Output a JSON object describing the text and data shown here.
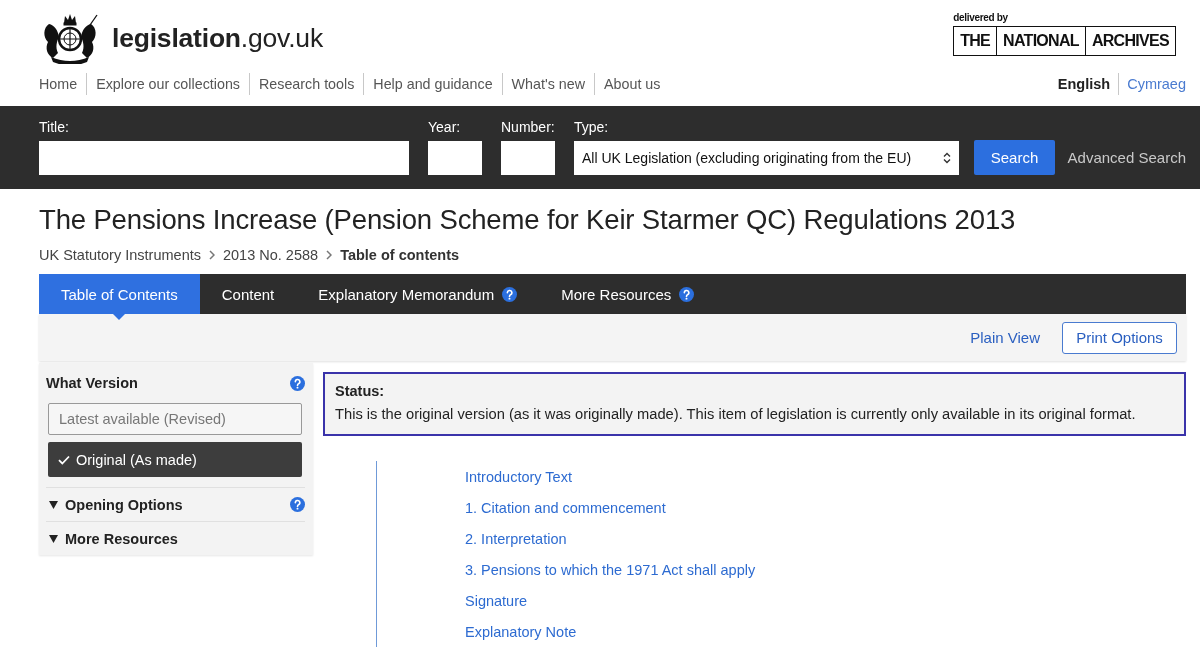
{
  "header": {
    "site_name": "**legislation**.gov.uk",
    "delivered_by": "delivered by",
    "archives_logo": [
      "THE",
      "NATIONAL",
      "ARCHIVES"
    ]
  },
  "nav": {
    "items": [
      "Home",
      "Explore our collections",
      "Research tools",
      "Help and guidance",
      "What's new",
      "About us"
    ],
    "languages": [
      {
        "label": "English",
        "selected": true
      },
      {
        "label": "Cymraeg",
        "selected": false
      }
    ]
  },
  "search": {
    "fields": [
      {
        "label": "Title:",
        "kind": "wide"
      },
      {
        "label": "Year:",
        "kind": "narrow"
      },
      {
        "label": "Number:",
        "kind": "narrow"
      },
      {
        "label": "Type:",
        "kind": "select",
        "value": "All UK Legislation (excluding originating from the EU)"
      }
    ],
    "button": "Search",
    "advanced_link": "Advanced Search"
  },
  "page_title": "The Pensions Increase (Pension Scheme for Keir Starmer QC) Regulations 2013",
  "breadcrumb": [
    {
      "label": "UK Statutory Instruments",
      "current": false
    },
    {
      "label": "2013 No. 2588",
      "current": false
    },
    {
      "label": "Table of contents",
      "current": true
    }
  ],
  "tabs": [
    {
      "label": "Table of Contents",
      "selected": true,
      "help": false
    },
    {
      "label": "Content",
      "selected": false,
      "help": false
    },
    {
      "label": "Explanatory Memorandum",
      "selected": false,
      "help": true
    },
    {
      "label": "More Resources",
      "selected": false,
      "help": true
    }
  ],
  "toolbar": {
    "plain_view": "Plain View",
    "print_options": "Print Options"
  },
  "sidebar": {
    "version": {
      "title": "What Version",
      "help": true,
      "options": [
        {
          "label": "Latest available (Revised)",
          "selected": false
        },
        {
          "label": "Original (As made)",
          "selected": true
        }
      ]
    },
    "sections": [
      {
        "title": "Opening Options",
        "help": true
      },
      {
        "title": "More Resources",
        "help": false
      }
    ]
  },
  "status": {
    "label": "Status:",
    "text": "This is the original version (as it was originally made). This item of legislation is currently only available in its original format."
  },
  "contents": [
    "Introductory Text",
    "1. Citation and commencement",
    "2. Interpretation",
    "3. Pensions to which the 1971 Act shall apply",
    "Signature",
    "Explanatory Note"
  ]
}
